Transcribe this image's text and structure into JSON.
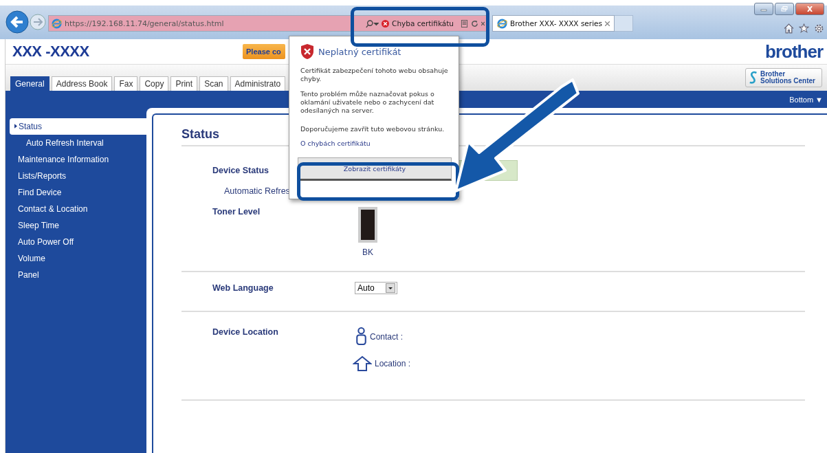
{
  "browser": {
    "address_bar": {
      "url": "https://192.168.11.74/general/status.html",
      "certificate_status": "Chyba certifikátu"
    },
    "tabs": [
      {
        "title": "Brother XXX- XXXX series",
        "selected": true
      }
    ]
  },
  "page": {
    "model": "XXX -XXXX",
    "notice": "Please co",
    "logo": "brother",
    "tabs": [
      {
        "label": "General",
        "selected": true
      },
      {
        "label": "Address Book",
        "selected": false
      },
      {
        "label": "Fax",
        "selected": false
      },
      {
        "label": "Copy",
        "selected": false
      },
      {
        "label": "Print",
        "selected": false
      },
      {
        "label": "Scan",
        "selected": false
      },
      {
        "label": "Administrato",
        "selected": false
      }
    ],
    "solutions_center": "Brother Solutions Center",
    "bottom_link": "Bottom ▼",
    "sidebar": [
      {
        "label": "Status",
        "selected": true,
        "children": [
          {
            "label": "Auto Refresh Interval",
            "selected": false
          }
        ]
      },
      {
        "label": "Maintenance Information",
        "selected": false
      },
      {
        "label": "Lists/Reports",
        "selected": false
      },
      {
        "label": "Find Device",
        "selected": false
      },
      {
        "label": "Contact & Location",
        "selected": false
      },
      {
        "label": "Sleep Time",
        "selected": false
      },
      {
        "label": "Auto Power Off",
        "selected": false
      },
      {
        "label": "Volume",
        "selected": false
      },
      {
        "label": "Panel",
        "selected": false
      }
    ],
    "heading": "Status",
    "device_status": {
      "label": "Device Status",
      "refresh_label": "Automatic Refres"
    },
    "toner": {
      "label": "Toner Level",
      "level": 1,
      "color_label": "BK"
    },
    "web_language": {
      "label": "Web Language",
      "value": "Auto"
    },
    "device_location": {
      "label": "Device Location",
      "contact": "Contact :",
      "location": "Location :"
    }
  },
  "popup": {
    "title": "Neplatný certifikát",
    "paragraphs": [
      "Certifikát zabezpečení tohoto webu obsahuje chyby.",
      "Tento problém může naznačovat pokus o oklamání uživatele nebo o zachycení dat odesílaných na server.",
      "Doporučujeme zavřít tuto webovou stránku."
    ],
    "link": "O chybách certifikátu",
    "button": "Zobrazit certifikáty"
  }
}
